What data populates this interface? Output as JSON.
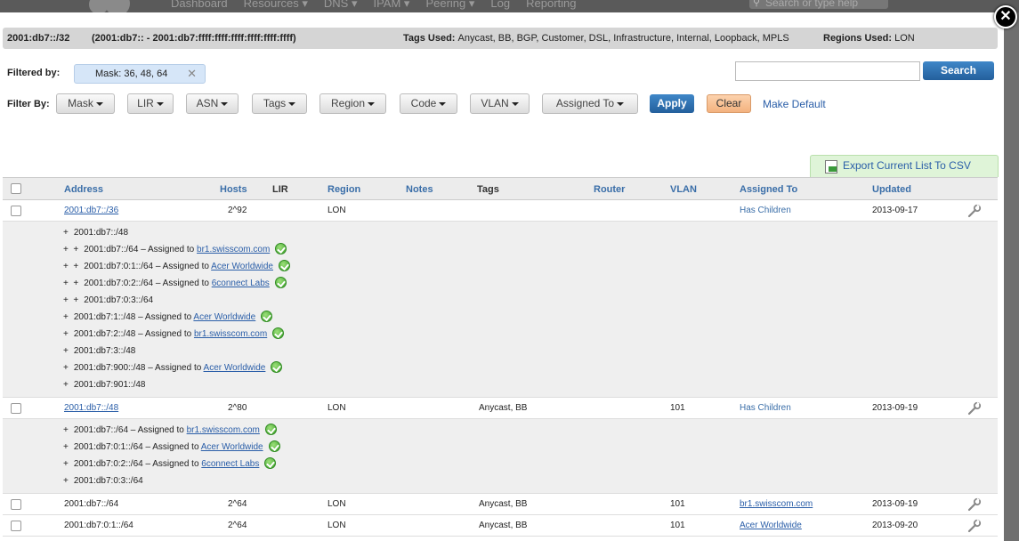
{
  "nav": {
    "items": [
      "Dashboard",
      "Resources ▾",
      "DNS ▾",
      "IPAM ▾",
      "Peering ▾",
      "Log",
      "Reporting"
    ],
    "search_placeholder": "Search or type help"
  },
  "modal": {
    "close_label": "✕",
    "info": {
      "prefix": "2001:db7::/32",
      "range": "(2001:db7:: - 2001:db7:ffff:ffff:ffff:ffff:ffff:ffff)",
      "tags_label": "Tags Used:",
      "tags_value": "Anycast, BB, BGP, Customer, DSL, Infrastructure, Internal, Loopback, MPLS",
      "regions_label": "Regions Used:",
      "regions_value": "LON"
    },
    "filtered_by_label": "Filtered by:",
    "filter_chip": "Mask: 36, 48, 64",
    "filter_chip_remove": "✕",
    "search_button": "Search",
    "filter_by_label": "Filter By:",
    "dropdowns": [
      "Mask",
      "LIR",
      "ASN",
      "Tags",
      "Region",
      "Code",
      "VLAN",
      "Assigned To"
    ],
    "apply_button": "Apply",
    "clear_button": "Clear",
    "make_default_link": "Make Default",
    "export_button": "Export Current List To CSV"
  },
  "table": {
    "columns": [
      "Address",
      "Hosts",
      "LIR",
      "Region",
      "Notes",
      "Tags",
      "Router",
      "VLAN",
      "Assigned To",
      "Updated"
    ],
    "rows": [
      {
        "address": "2001:db7::/36",
        "hosts": "2^92",
        "region": "LON",
        "tags": "",
        "vlan": "",
        "assigned": "Has Children",
        "updated": "2013-09-17"
      },
      {
        "address": "2001:db7::/48",
        "hosts": "2^80",
        "region": "LON",
        "tags": "Anycast, BB",
        "vlan": "101",
        "assigned": "Has Children",
        "updated": "2013-09-19"
      },
      {
        "address": "2001:db7::/64",
        "hosts": "2^64",
        "region": "LON",
        "tags": "Anycast, BB",
        "vlan": "101",
        "assigned": "br1.swisscom.com",
        "updated": "2013-09-19"
      },
      {
        "address": "2001:db7:0:1::/64",
        "hosts": "2^64",
        "region": "LON",
        "tags": "Anycast, BB",
        "vlan": "101",
        "assigned": "Acer Worldwide",
        "updated": "2013-09-20"
      }
    ],
    "children1": [
      {
        "prefix": "+",
        "text": "2001:db7::/48",
        "assigned_text": "",
        "assigned": ""
      },
      {
        "prefix": "+  +",
        "text": "2001:db7::/64 – Assigned to ",
        "assigned": "br1.swisscom.com"
      },
      {
        "prefix": "+  +",
        "text": "2001:db7:0:1::/64 – Assigned to ",
        "assigned": "Acer Worldwide"
      },
      {
        "prefix": "+  +",
        "text": "2001:db7:0:2::/64 – Assigned to ",
        "assigned": "6connect Labs"
      },
      {
        "prefix": "+  +",
        "text": "2001:db7:0:3::/64",
        "assigned": ""
      },
      {
        "prefix": "+",
        "text": "2001:db7:1::/48 – Assigned to ",
        "assigned": "Acer Worldwide"
      },
      {
        "prefix": "+",
        "text": "2001:db7:2::/48 – Assigned to ",
        "assigned": "br1.swisscom.com"
      },
      {
        "prefix": "+",
        "text": "2001:db7:3::/48",
        "assigned": ""
      },
      {
        "prefix": "+",
        "text": "2001:db7:900::/48 – Assigned to ",
        "assigned": "Acer Worldwide"
      },
      {
        "prefix": "+",
        "text": "2001:db7:901::/48",
        "assigned": ""
      }
    ],
    "children2": [
      {
        "prefix": "+",
        "text": "2001:db7::/64 – Assigned to ",
        "assigned": "br1.swisscom.com"
      },
      {
        "prefix": "+",
        "text": "2001:db7:0:1::/64 – Assigned to ",
        "assigned": "Acer Worldwide"
      },
      {
        "prefix": "+",
        "text": "2001:db7:0:2::/64 – Assigned to ",
        "assigned": "6connect Labs"
      },
      {
        "prefix": "+",
        "text": "2001:db7:0:3::/64",
        "assigned": ""
      }
    ]
  },
  "colors": {
    "accent_blue": "#2a5ea8",
    "button_blue": "#235f9c",
    "clear_orange": "#f3b27f",
    "export_green": "#dff4d8",
    "assigned_check": "#3a9f28"
  }
}
